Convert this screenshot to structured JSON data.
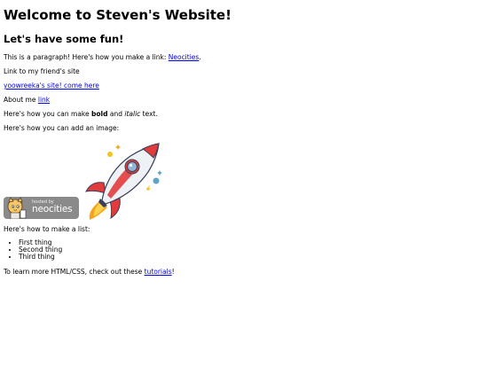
{
  "heading": "Welcome to Steven's Website!",
  "subheading": "Let's have some fun!",
  "paragraph1": {
    "text": "This is a paragraph! Here's how you make a link: ",
    "link_label": "Neocities",
    "after": "."
  },
  "friend_intro": "Link to my friend's site",
  "friend_link": "yoowreeka's site! come here",
  "about": {
    "text": "About me ",
    "link_label": "link"
  },
  "formatting": {
    "before": "Here's how you can make ",
    "bold": "bold",
    "middle": " and ",
    "italic": "italic",
    "after": " text."
  },
  "image_intro": "Here's how you can add an image:",
  "badge": {
    "small": "hosted by",
    "big": "neocities"
  },
  "list_intro": "Here's how to make a list:",
  "list_items": [
    "First thing",
    "Second thing",
    "Third thing"
  ],
  "outro": {
    "before": "To learn more HTML/CSS, check out these ",
    "link_label": "tutorials",
    "after": "!"
  }
}
